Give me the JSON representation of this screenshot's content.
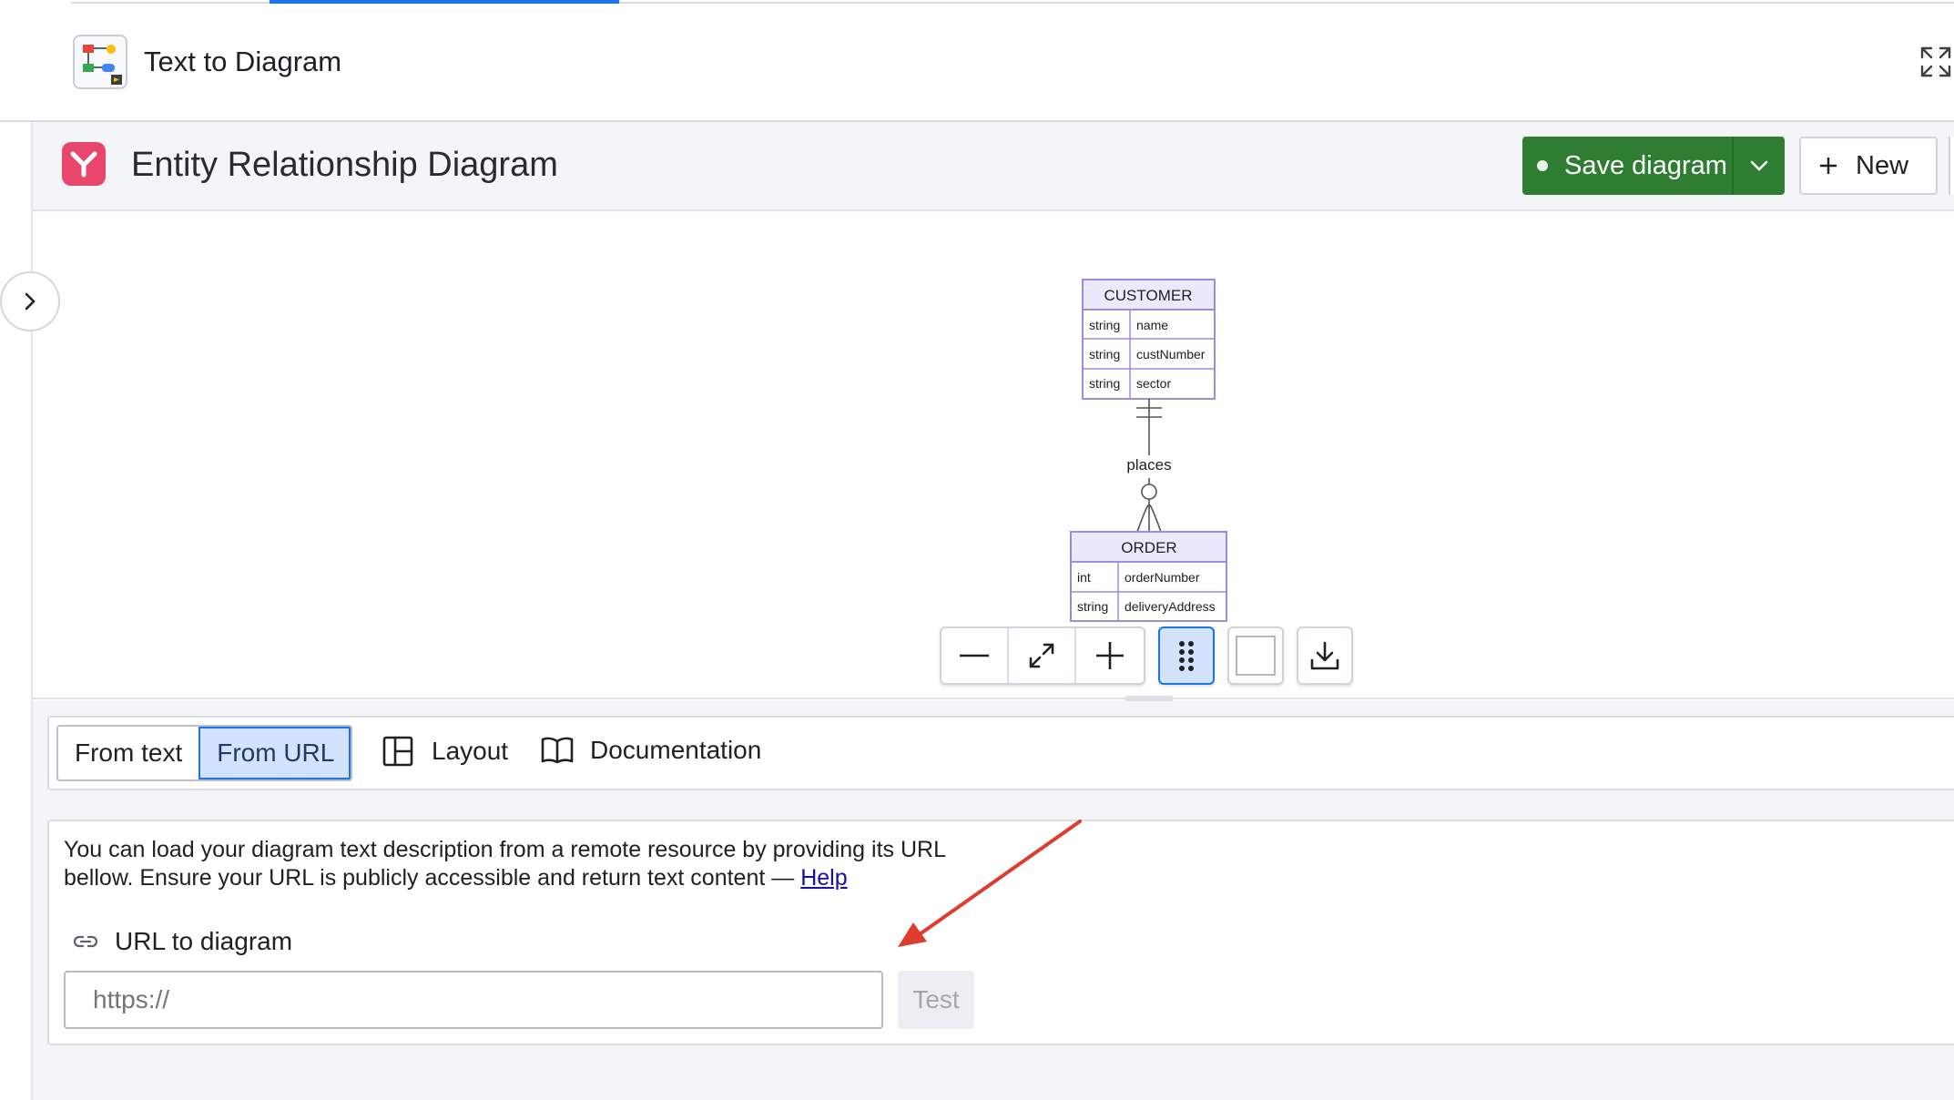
{
  "app": {
    "title": "Text to Diagram",
    "icon": "diagram-app-icon"
  },
  "header": {
    "title": "Entity Relationship Diagram",
    "logo_icon": "y-logo-icon",
    "save_label": "Save diagram",
    "new_label": "New",
    "brand_color": "#e8466c",
    "save_color": "#2e7d32"
  },
  "diagram": {
    "entities": [
      {
        "name": "CUSTOMER",
        "attributes": [
          {
            "type": "string",
            "name": "name"
          },
          {
            "type": "string",
            "name": "custNumber"
          },
          {
            "type": "string",
            "name": "sector"
          }
        ]
      },
      {
        "name": "ORDER",
        "attributes": [
          {
            "type": "int",
            "name": "orderNumber"
          },
          {
            "type": "string",
            "name": "deliveryAddress"
          }
        ]
      }
    ],
    "relationship": {
      "label": "places",
      "from": "CUSTOMER",
      "to": "ORDER",
      "from_cardinality": "exactly-one",
      "to_cardinality": "zero-or-more"
    },
    "entity_fill": "#ece9fc",
    "entity_stroke": "#9a8ce0"
  },
  "toolbar": {
    "buttons": [
      "zoom-out",
      "fit",
      "zoom-in",
      "drag-handle",
      "background",
      "download"
    ],
    "active": "drag-handle"
  },
  "source_tabs": {
    "from_text": "From text",
    "from_url": "From URL",
    "active": "From URL",
    "layout": "Layout",
    "documentation": "Documentation"
  },
  "url_panel": {
    "description": "You can load your diagram text description from a remote resource by providing its URL bellow. Ensure your URL is publicly accessible and return text content —",
    "help": "Help",
    "field_label": "URL to diagram",
    "placeholder": "https://",
    "value": "",
    "test_label": "Test"
  },
  "annotation": {
    "arrow_color": "#e03b2f"
  }
}
